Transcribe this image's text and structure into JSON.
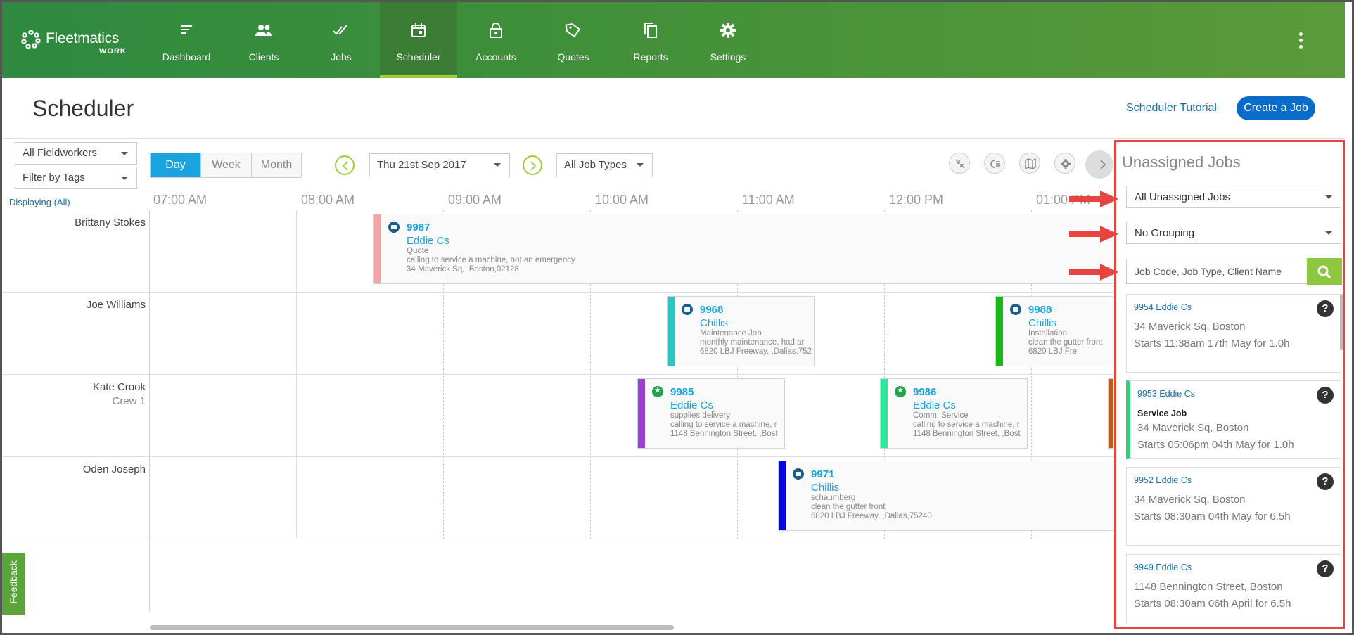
{
  "brand": {
    "name": "Fleetmatics",
    "sub": "WORK"
  },
  "nav": [
    {
      "label": "Dashboard",
      "icon": "dashboard-icon"
    },
    {
      "label": "Clients",
      "icon": "clients-icon"
    },
    {
      "label": "Jobs",
      "icon": "jobs-icon"
    },
    {
      "label": "Scheduler",
      "icon": "calendar-icon",
      "active": true
    },
    {
      "label": "Accounts",
      "icon": "lock-icon"
    },
    {
      "label": "Quotes",
      "icon": "tag-icon"
    },
    {
      "label": "Reports",
      "icon": "copy-icon"
    },
    {
      "label": "Settings",
      "icon": "gear-icon"
    }
  ],
  "header": {
    "title": "Scheduler",
    "tutorial": "Scheduler Tutorial",
    "create": "Create a Job"
  },
  "filters": {
    "fieldworkers": "All Fieldworkers",
    "tags": "Filter by Tags",
    "views": [
      "Day",
      "Week",
      "Month"
    ],
    "active_view": "Day",
    "date": "Thu 21st Sep 2017",
    "job_types": "All Job Types",
    "displaying": "Displaying (All)"
  },
  "times": [
    "07:00 AM",
    "08:00 AM",
    "09:00 AM",
    "10:00 AM",
    "11:00 AM",
    "12:00 PM",
    "01:00 PM"
  ],
  "workers": [
    {
      "name": "Brittany Stokes",
      "crew": ""
    },
    {
      "name": "Joe Williams",
      "crew": ""
    },
    {
      "name": "Kate Crook",
      "crew": "Crew 1"
    },
    {
      "name": "Oden Joseph",
      "crew": ""
    }
  ],
  "jobs": [
    {
      "code": "9987",
      "client": "Eddie Cs",
      "type": "Quote",
      "desc": "calling to service a machine, not an emergency",
      "addr": "34 Maverick Sq, ,Boston,02128",
      "color": "#f4a5a5"
    },
    {
      "code": "9968",
      "client": "Chillis",
      "type": "Maintenance Job",
      "desc": "monthly maintenance, had ar",
      "addr": "6820 LBJ Freeway, ,Dallas,752",
      "color": "#2fc4c4"
    },
    {
      "code": "9988",
      "client": "Chillis",
      "type": "Installation",
      "desc": "clean the gutter front",
      "addr": "6820 LBJ Fre",
      "color": "#18b818"
    },
    {
      "code": "9985",
      "client": "Eddie Cs",
      "type": "supplies delivery",
      "desc": "calling to service a machine, r",
      "addr": "1148 Bennington Street, ,Bost",
      "color": "#9a3fd0"
    },
    {
      "code": "9986",
      "client": "Eddie Cs",
      "type": "Comm. Service",
      "desc": "calling to service a machine, r",
      "addr": "1148 Bennington Street, ,Bost",
      "color": "#2ee89a"
    },
    {
      "code": "9971",
      "client": "Chillis",
      "type": "schaumberg",
      "desc": "clean the gutter front",
      "addr": "6820 LBJ Freeway, ,Dallas,75240",
      "color": "#0a0adc"
    }
  ],
  "feedback": "Feedback",
  "unassigned": {
    "title": "Unassigned Jobs",
    "filter": "All Unassigned Jobs",
    "grouping": "No Grouping",
    "search_placeholder": "Job Code, Job Type, Client Name",
    "cards": [
      {
        "title": "9954 Eddie Cs",
        "type": "",
        "addr": "34 Maverick Sq, Boston",
        "start": "Starts 11:38am 17th May for 1.0h"
      },
      {
        "title": "9953 Eddie Cs",
        "type": "Service Job",
        "addr": "34 Maverick Sq, Boston",
        "start": "Starts 05:06pm 04th May for 1.0h"
      },
      {
        "title": "9952 Eddie Cs",
        "type": "",
        "addr": "34 Maverick Sq, Boston",
        "start": "Starts 08:30am 04th May for 6.5h"
      },
      {
        "title": "9949 Eddie Cs",
        "type": "",
        "addr": "1148 Bennington Street, Boston",
        "start": "Starts 08:30am 06th April for 6.5h"
      }
    ]
  }
}
